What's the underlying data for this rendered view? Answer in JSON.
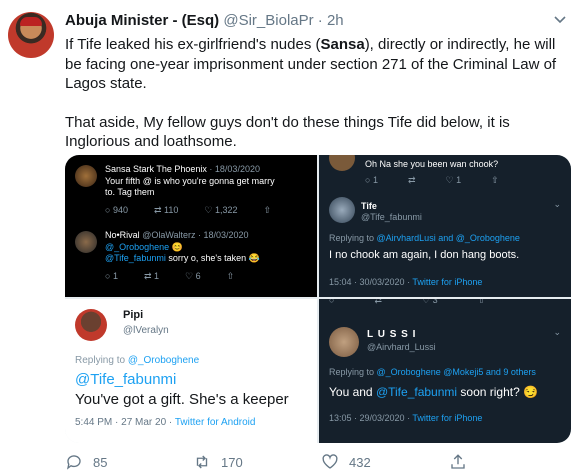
{
  "tweet": {
    "name": "Abuja Minister - (Esq)",
    "handle": "@Sir_BiolaPr",
    "time": "· 2h",
    "para1_a": "If Tife leaked his ex-girlfriend's nudes (",
    "para1_b": "Sansa",
    "para1_c": "), directly or indirectly, he will be facing one-year imprisonment under section 271 of the Criminal Law of Lagos state.",
    "para2": "That aside, My fellow guys don't do these things Tife did below, it is Inglorious and loathsome."
  },
  "p1": {
    "name1": "Sansa Stark The Phoenix",
    "date1": "· 18/03/2020",
    "text1a": "Your fifth @ is who you're gonna get marry",
    "text1b": "to. Tag them",
    "c1": "940",
    "r1": "110",
    "l1": "1,322",
    "name2": "No•Rival",
    "handle2": "@OlaWalterz · 18/03/2020",
    "mention2a": "@_Oroboghene 😊",
    "mention2b": "@Tife_fabunmi",
    "text2": " sorry o, she's taken 😂",
    "c2": "1",
    "r2": "1",
    "l2": "6"
  },
  "p2": {
    "topline": "Oh Na she you been wan chook?",
    "c": "1",
    "l": "1",
    "name": "Tife",
    "handle": "@Tife_fabunmi",
    "replying": "Replying to ",
    "replying_to": "@AirvhardLusi and @_Oroboghene",
    "text": "I no chook am again, I don hang boots.",
    "time": "15:04 · 30/03/2020 · ",
    "source": "Twitter for iPhone",
    "bottom_count": "3"
  },
  "p3": {
    "name": "Pipi",
    "handle": "@lVeralyn",
    "replying": "Replying to ",
    "replying_to": "@_Oroboghene",
    "mention": "@Tife_fabunmi",
    "text": "You've got a gift. She's a keeper",
    "time": "5:44 PM · 27 Mar 20 · ",
    "source": "Twitter for Android"
  },
  "p4": {
    "name": "L U S S I",
    "handle": "@Airvhard_Lussi",
    "replying": "Replying to ",
    "replying_to": "@_Oroboghene @Mokeji5 and 9 others",
    "text_a": "You and ",
    "mention": "@Tife_fabunmi",
    "text_b": " soon right? 😏",
    "time": "13:05 · 29/03/2020 · ",
    "source": "Twitter for iPhone"
  },
  "footer": {
    "replies": "85",
    "retweets": "170",
    "likes": "432"
  }
}
